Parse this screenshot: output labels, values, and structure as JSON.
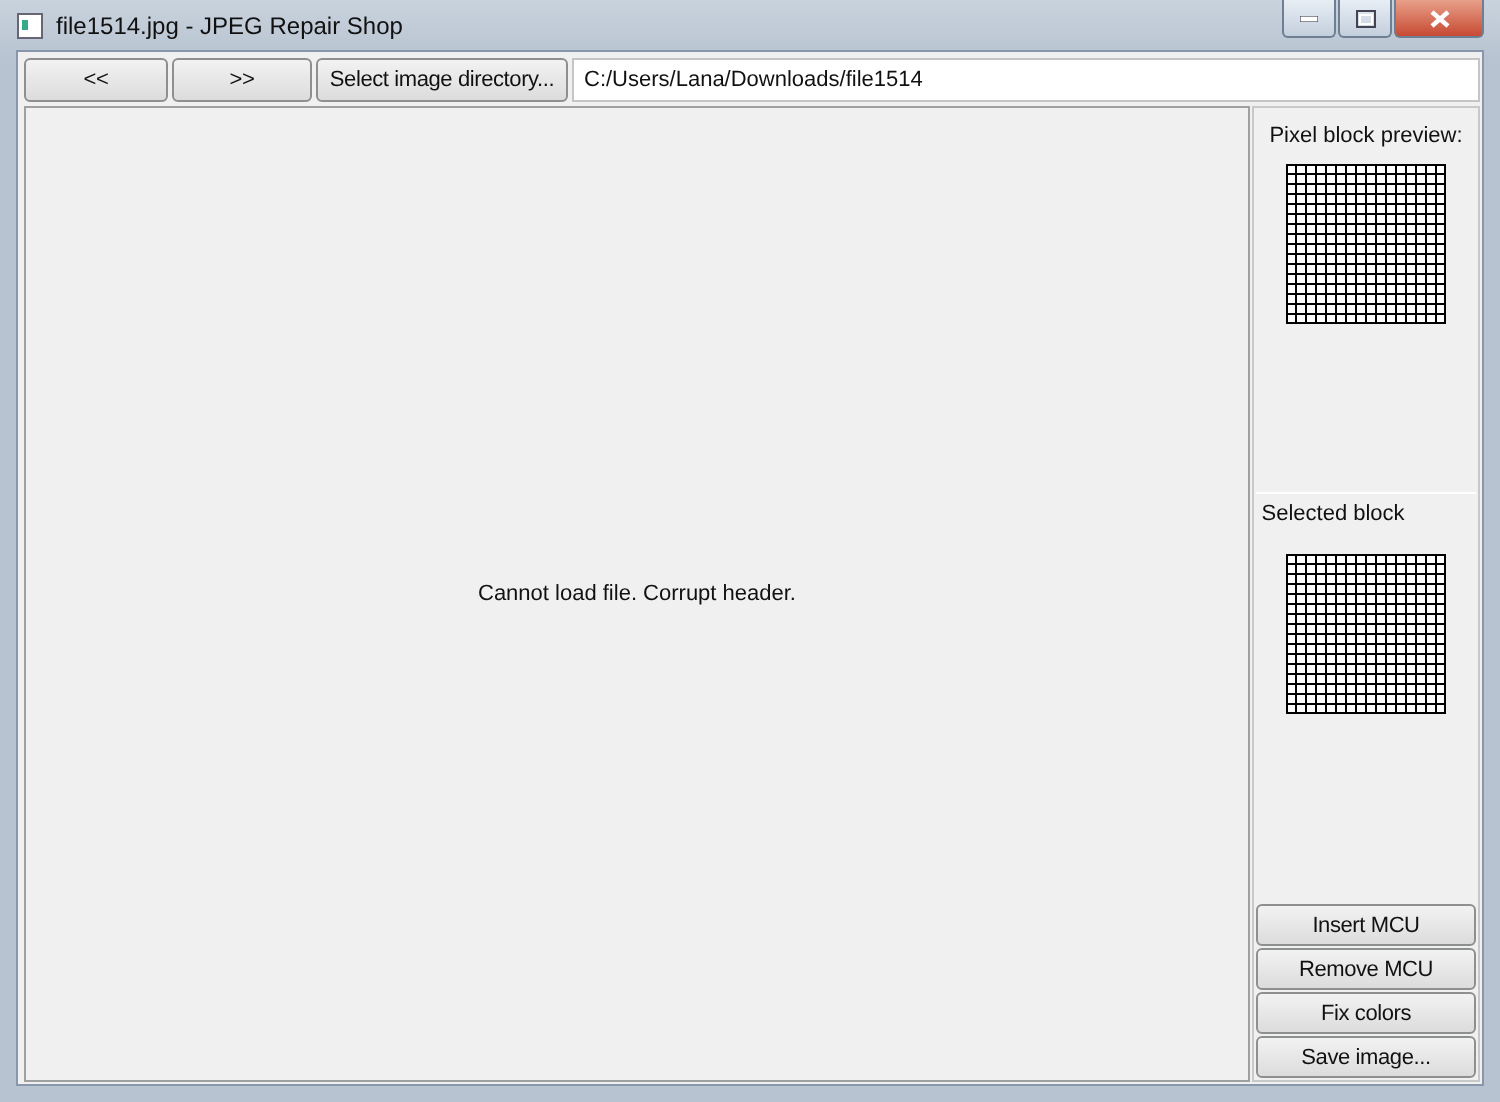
{
  "window": {
    "title": "file1514.jpg - JPEG Repair Shop"
  },
  "toolbar": {
    "buttons": [
      "<<",
      ">>",
      "Select image directory..."
    ],
    "path": "C:/Users/Lana/Downloads/file1514"
  },
  "viewer": {
    "message": "Cannot load file. Corrupt header."
  },
  "side_panel": {
    "preview_label": "Pixel block preview:",
    "selected_label": "Selected block",
    "buttons": [
      "Insert MCU",
      "Remove MCU",
      "Fix colors",
      "Save image..."
    ]
  }
}
